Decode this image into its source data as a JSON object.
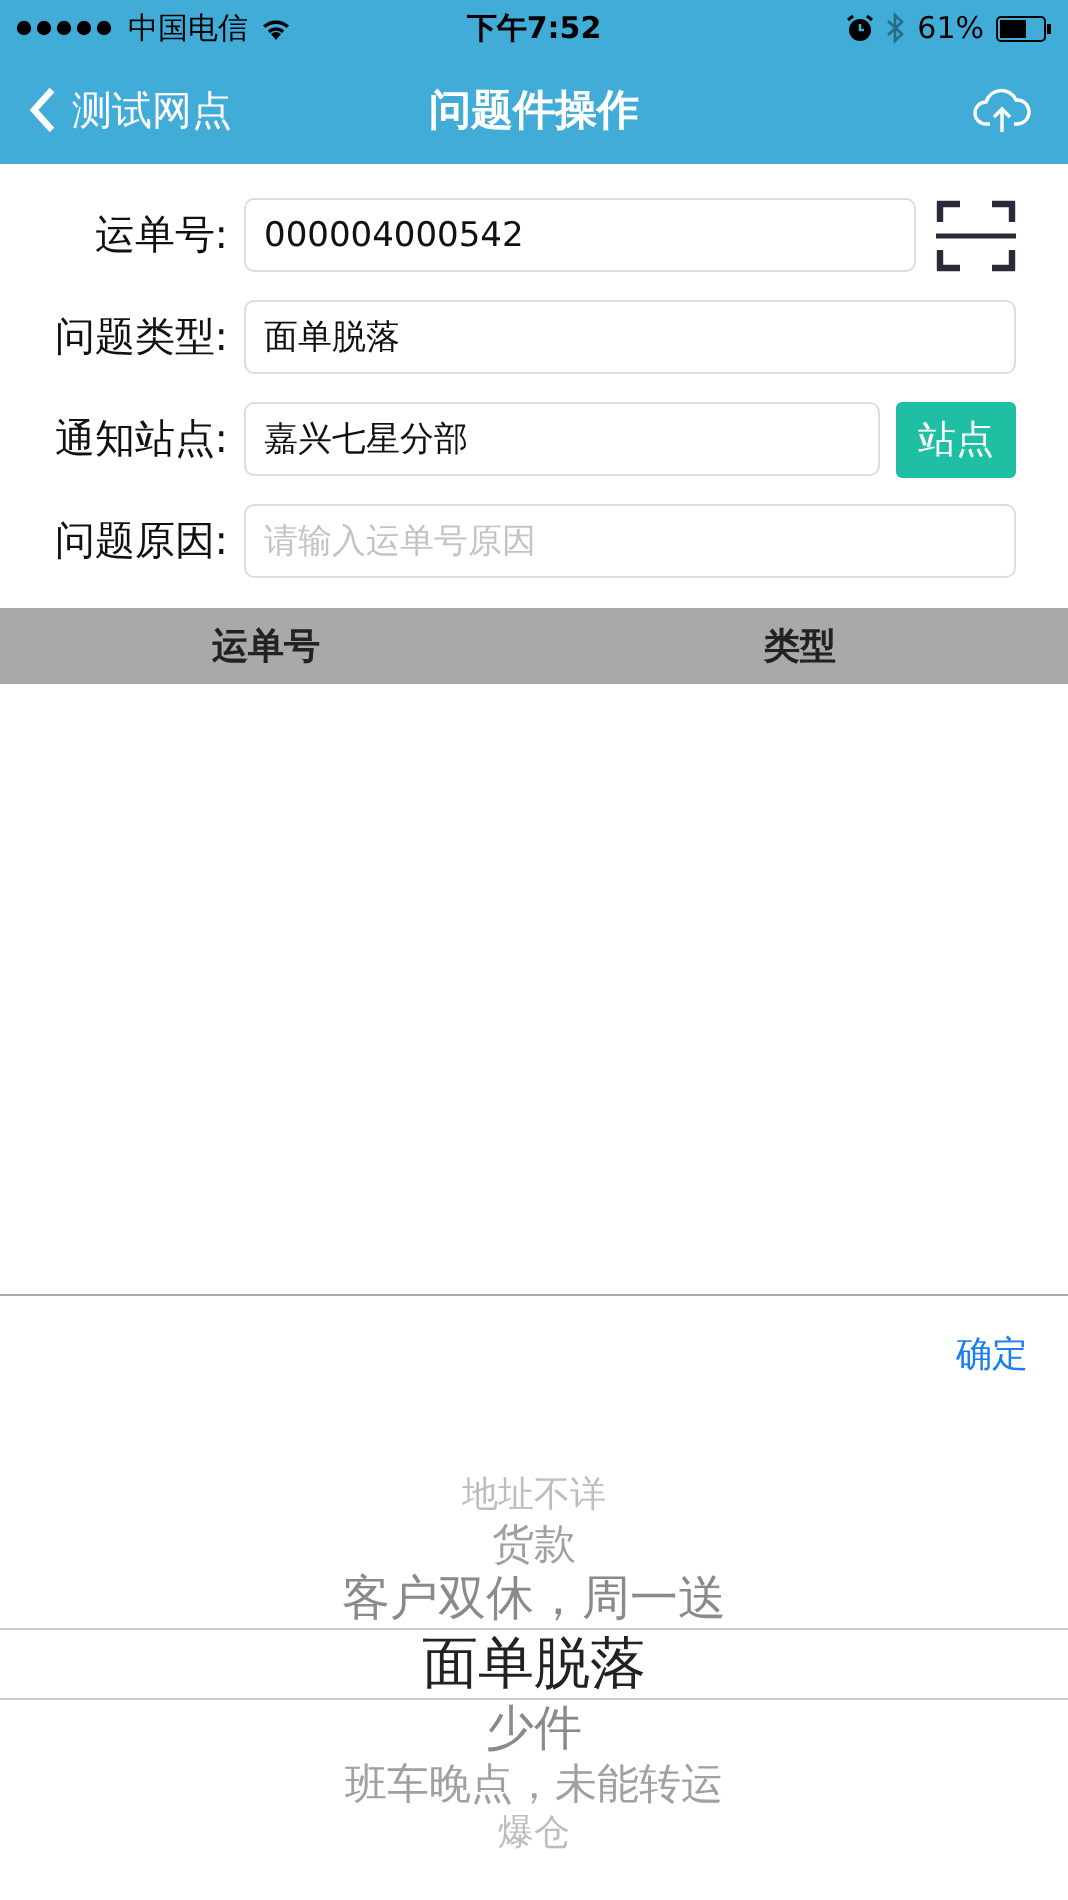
{
  "status_bar": {
    "carrier": "中国电信",
    "time": "下午7:52",
    "battery": "61%"
  },
  "nav_bar": {
    "back": "测试网点",
    "title": "问题件操作"
  },
  "form": [
    {
      "label": "运单号:",
      "value": "000004000542",
      "accessory": {
        "kind": "scan"
      }
    },
    {
      "label": "问题类型:",
      "value": "面单脱落"
    },
    {
      "label": "通知站点:",
      "value": "嘉兴七星分部",
      "accessory": {
        "kind": "button",
        "label": "站点"
      }
    },
    {
      "label": "问题原因:",
      "placeholder": "请输入运单号原因"
    }
  ],
  "table": {
    "columns": [
      "运单号",
      "类型"
    ]
  },
  "picker": {
    "done": "确定",
    "options": [
      {
        "label": "地址不详",
        "selected": false
      },
      {
        "label": "货款",
        "selected": false
      },
      {
        "label": "客户双休，周一送",
        "selected": false
      },
      {
        "label": "面单脱落",
        "selected": true
      },
      {
        "label": "少件",
        "selected": false
      },
      {
        "label": "班车晚点，未能转运",
        "selected": false
      },
      {
        "label": "爆仓",
        "selected": false
      }
    ]
  }
}
